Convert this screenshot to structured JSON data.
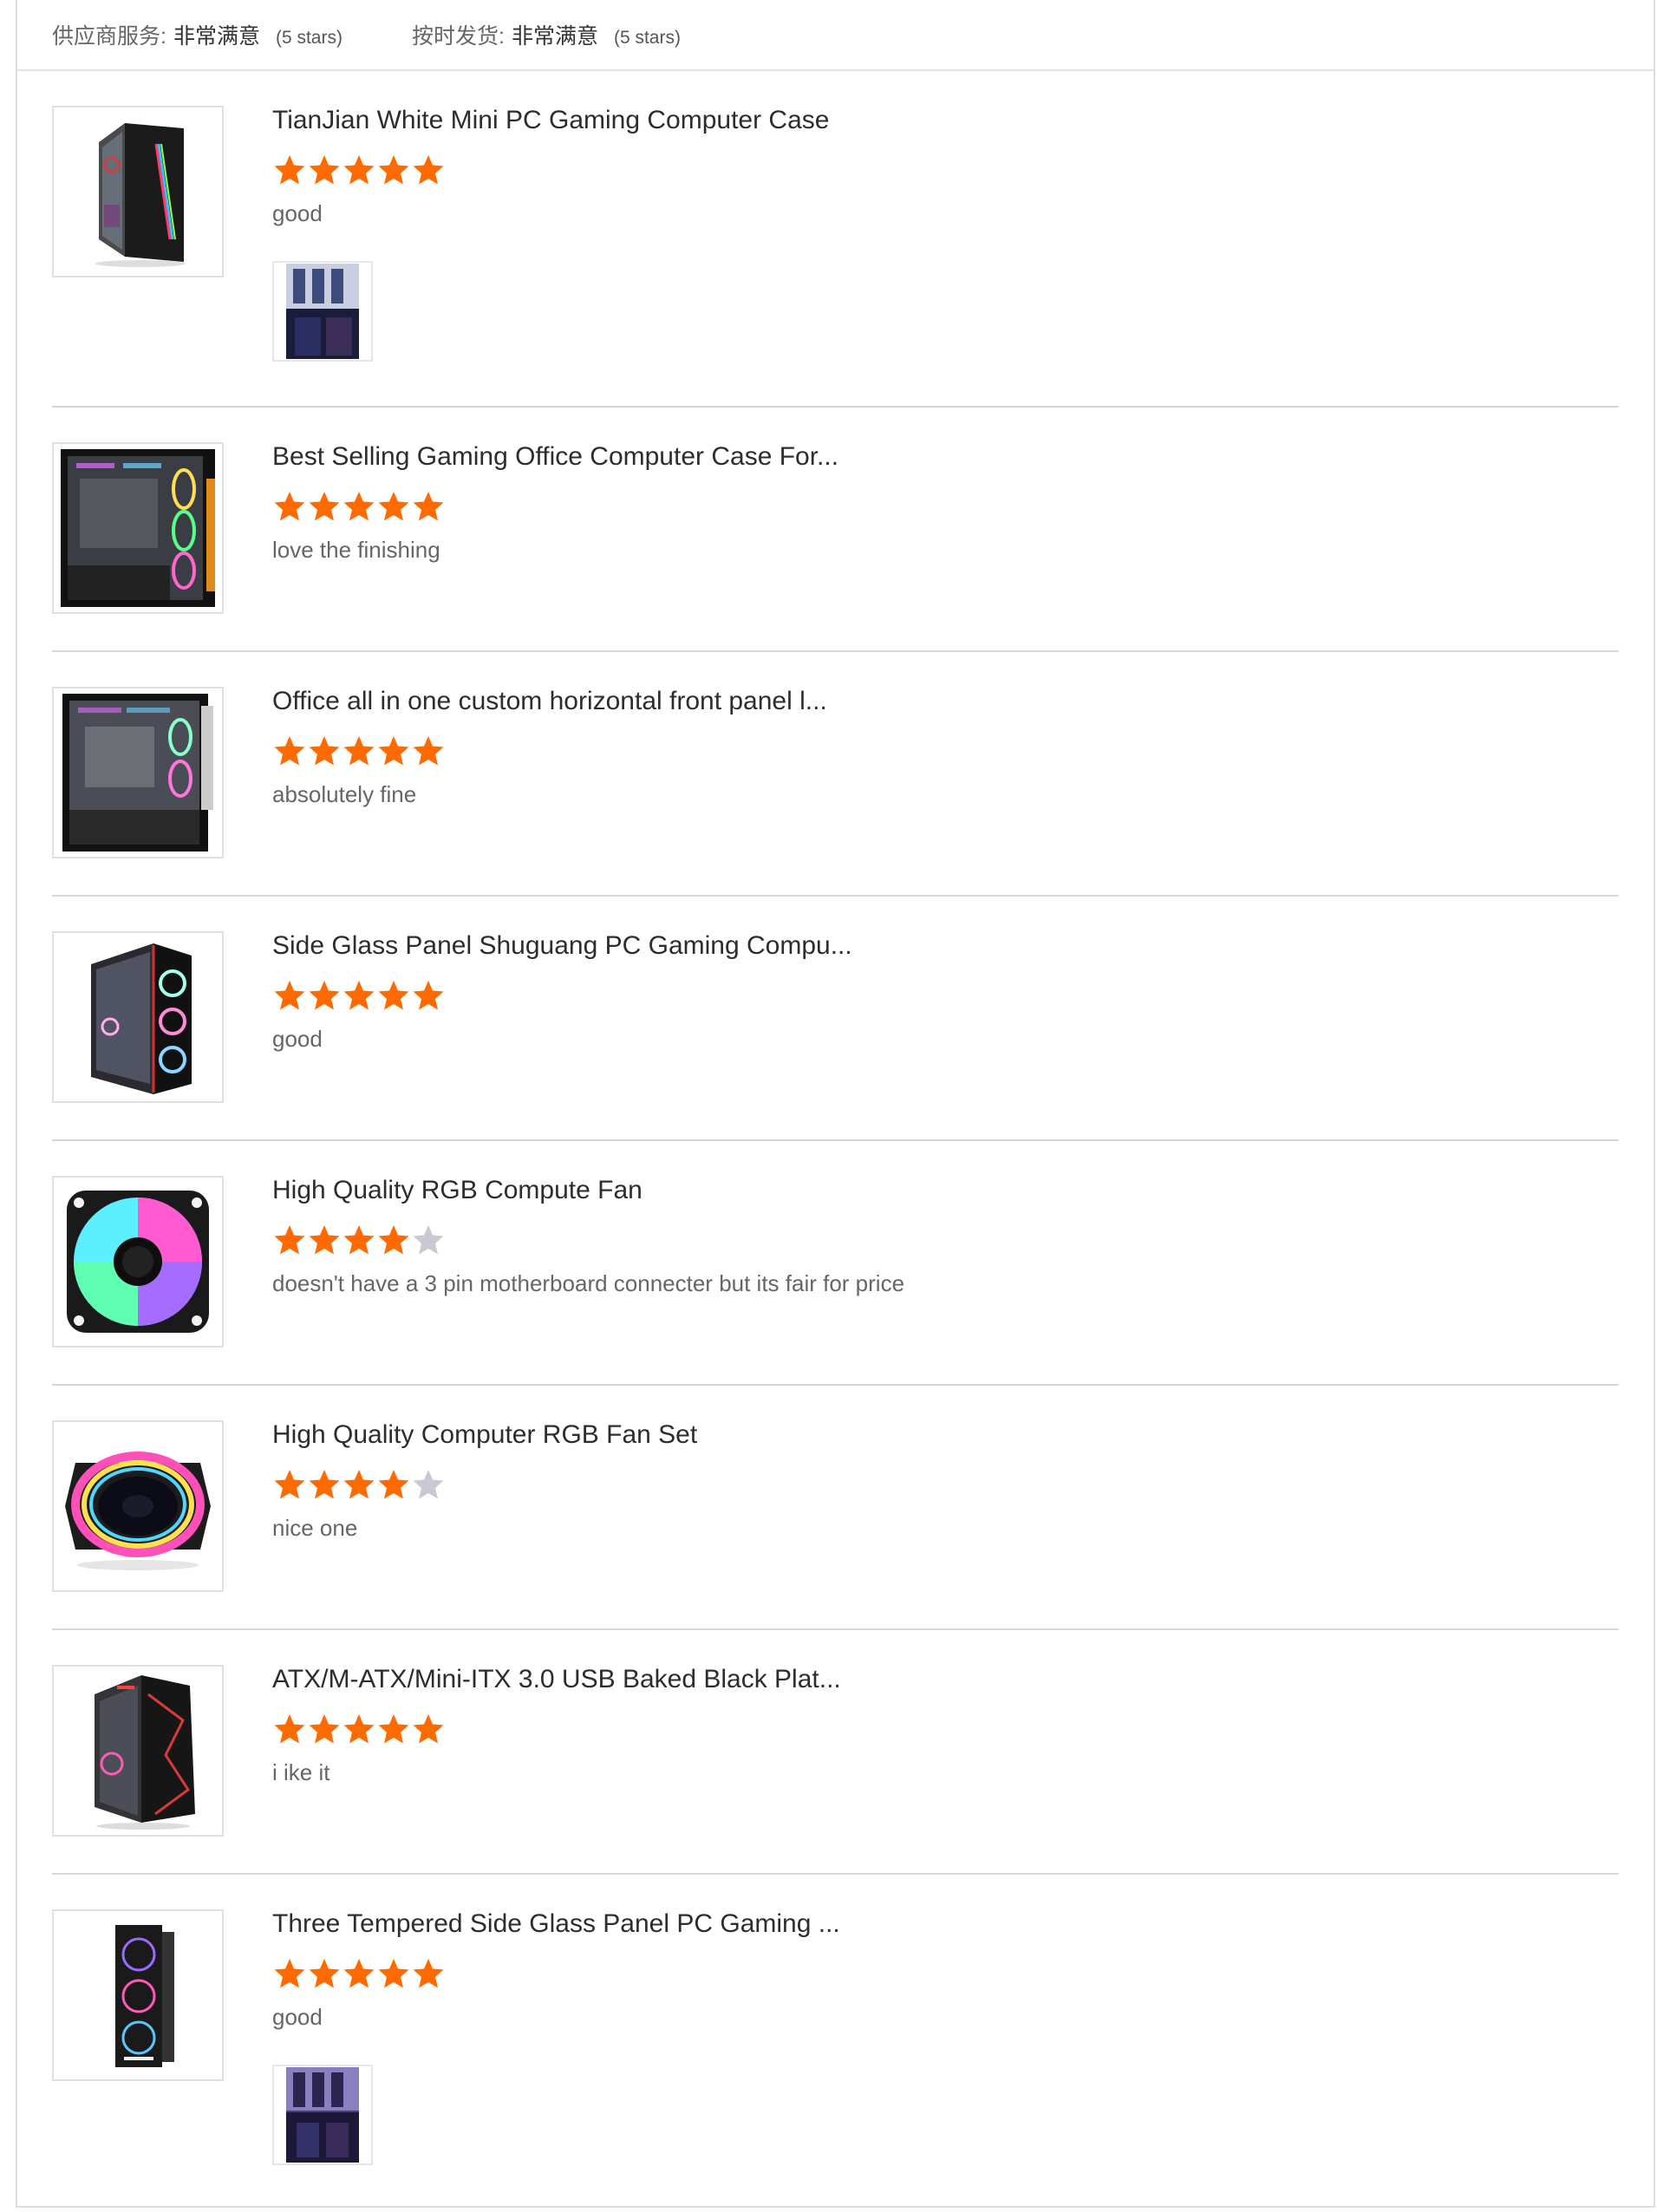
{
  "summary": {
    "items": [
      {
        "label": "供应商服务:",
        "value": "非常满意",
        "stars_text": "(5 stars)",
        "rating": 5
      },
      {
        "label": "按时发货:",
        "value": "非常满意",
        "stars_text": "(5 stars)",
        "rating": 5
      }
    ]
  },
  "colors": {
    "star_filled": "#ff6a00",
    "star_empty": "#c9c9d4"
  },
  "reviews": [
    {
      "title": "TianJian White Mini PC Gaming Computer Case",
      "rating": 5,
      "comment": "good",
      "thumb_icon": "pc-case-rgb-strip-icon",
      "has_photo": true
    },
    {
      "title": "Best Selling Gaming Office Computer Case For...",
      "rating": 5,
      "comment": "love the finishing",
      "thumb_icon": "pc-case-glass-panel-icon",
      "has_photo": false
    },
    {
      "title": "Office all in one custom horizontal front panel l...",
      "rating": 5,
      "comment": "absolutely fine",
      "thumb_icon": "pc-case-glass-panel-icon",
      "has_photo": false
    },
    {
      "title": "Side Glass Panel Shuguang PC Gaming Compu...",
      "rating": 5,
      "comment": "good",
      "thumb_icon": "pc-case-ring-fans-icon",
      "has_photo": false
    },
    {
      "title": "High Quality RGB Compute Fan",
      "rating": 4,
      "comment": "doesn't have a 3 pin motherboard connecter but its fair for price",
      "thumb_icon": "rgb-fan-icon",
      "has_photo": false
    },
    {
      "title": "High Quality Computer RGB Fan Set",
      "rating": 4,
      "comment": "nice one",
      "thumb_icon": "rgb-ring-fan-icon",
      "has_photo": false
    },
    {
      "title": "ATX/M-ATX/Mini-ITX 3.0 USB Baked Black Plat...",
      "rating": 5,
      "comment": "i ike it",
      "thumb_icon": "pc-case-angular-icon",
      "has_photo": false
    },
    {
      "title": "Three Tempered Side Glass Panel PC Gaming ...",
      "rating": 5,
      "comment": "good",
      "thumb_icon": "pc-case-tower-three-fans-icon",
      "has_photo": true
    }
  ]
}
